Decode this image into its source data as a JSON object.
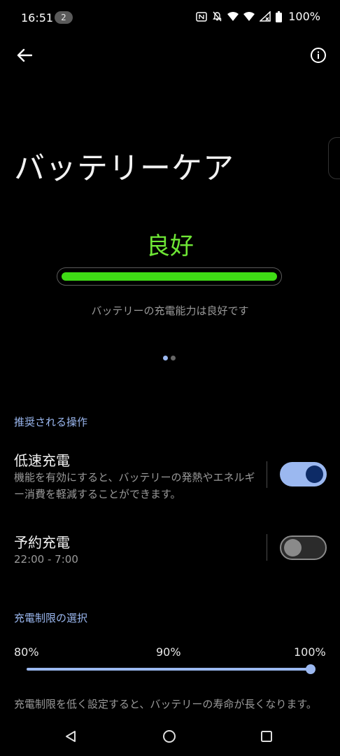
{
  "status_bar": {
    "time": "16:51",
    "notification_count": "2",
    "battery_percent": "100%",
    "icons": [
      "nfc-icon",
      "mute-icon",
      "wifi-icon",
      "wifi-icon",
      "signal-icon",
      "battery-icon"
    ]
  },
  "header": {
    "back_icon": "arrow-left-icon",
    "info_icon": "info-icon",
    "title": "バッテリーケア"
  },
  "health": {
    "status_label": "良好",
    "status_color": "#6ee635",
    "level_fraction": 1.0,
    "description": "バッテリーの充電能力は良好です",
    "pager": {
      "count": 2,
      "active_index": 0
    }
  },
  "recommended": {
    "header": "推奨される操作",
    "items": [
      {
        "title": "低速充電",
        "description": "機能を有効にすると、バッテリーの発熱やエネルギー消費を軽減することができます。",
        "enabled": true
      },
      {
        "title": "予約充電",
        "description": "22:00 - 7:00",
        "enabled": false
      }
    ]
  },
  "charge_limit": {
    "header": "充電制限の選択",
    "options": [
      "80%",
      "90%",
      "100%"
    ],
    "selected": "100%",
    "footnote": "充電制限を低く設定すると、バッテリーの寿命が長くなります。"
  },
  "nav_bar": {
    "back_icon": "nav-back-icon",
    "home_icon": "nav-home-icon",
    "recents_icon": "nav-recents-icon"
  },
  "colors": {
    "accent": "#9bb8f0",
    "good": "#3fdc15",
    "toggle_on_track": "#9bb8f0",
    "toggle_on_thumb": "#0d2b66"
  }
}
